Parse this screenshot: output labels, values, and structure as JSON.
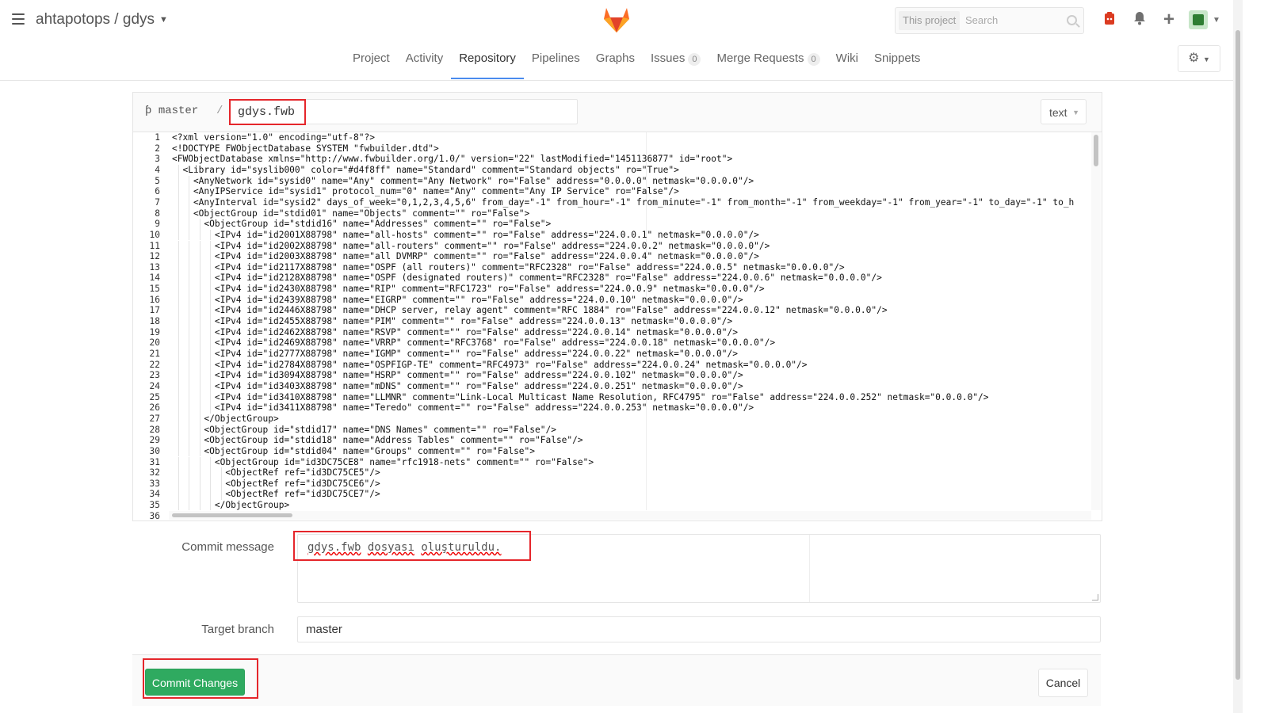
{
  "header": {
    "project_namespace": "ahtapotops",
    "project_separator": " / ",
    "project_name": "gdys",
    "search_scope": "This project",
    "search_placeholder": "Search",
    "icons": [
      "hamburger-icon",
      "gitlab-logo",
      "search-icon",
      "todo-icon",
      "bell-icon",
      "plus-icon",
      "avatar",
      "chevron-down-icon",
      "gear-icon"
    ]
  },
  "nav": {
    "tabs": [
      {
        "label": "Project"
      },
      {
        "label": "Activity"
      },
      {
        "label": "Repository",
        "active": true
      },
      {
        "label": "Pipelines"
      },
      {
        "label": "Graphs"
      },
      {
        "label": "Issues",
        "count": "0"
      },
      {
        "label": "Merge Requests",
        "count": "0"
      },
      {
        "label": "Wiki"
      },
      {
        "label": "Snippets"
      }
    ]
  },
  "file": {
    "branch": "master",
    "separator": "/",
    "filename": "gdys.fwb",
    "mode": "text"
  },
  "editor": {
    "lines": [
      "<?xml version=\"1.0\" encoding=\"utf-8\"?>",
      "<!DOCTYPE FWObjectDatabase SYSTEM \"fwbuilder.dtd\">",
      "<FWObjectDatabase xmlns=\"http://www.fwbuilder.org/1.0/\" version=\"22\" lastModified=\"1451136877\" id=\"root\">",
      "  <Library id=\"syslib000\" color=\"#d4f8ff\" name=\"Standard\" comment=\"Standard objects\" ro=\"True\">",
      "    <AnyNetwork id=\"sysid0\" name=\"Any\" comment=\"Any Network\" ro=\"False\" address=\"0.0.0.0\" netmask=\"0.0.0.0\"/>",
      "    <AnyIPService id=\"sysid1\" protocol_num=\"0\" name=\"Any\" comment=\"Any IP Service\" ro=\"False\"/>",
      "    <AnyInterval id=\"sysid2\" days_of_week=\"0,1,2,3,4,5,6\" from_day=\"-1\" from_hour=\"-1\" from_minute=\"-1\" from_month=\"-1\" from_weekday=\"-1\" from_year=\"-1\" to_day=\"-1\" to_h",
      "    <ObjectGroup id=\"stdid01\" name=\"Objects\" comment=\"\" ro=\"False\">",
      "      <ObjectGroup id=\"stdid16\" name=\"Addresses\" comment=\"\" ro=\"False\">",
      "        <IPv4 id=\"id2001X88798\" name=\"all-hosts\" comment=\"\" ro=\"False\" address=\"224.0.0.1\" netmask=\"0.0.0.0\"/>",
      "        <IPv4 id=\"id2002X88798\" name=\"all-routers\" comment=\"\" ro=\"False\" address=\"224.0.0.2\" netmask=\"0.0.0.0\"/>",
      "        <IPv4 id=\"id2003X88798\" name=\"all DVMRP\" comment=\"\" ro=\"False\" address=\"224.0.0.4\" netmask=\"0.0.0.0\"/>",
      "        <IPv4 id=\"id2117X88798\" name=\"OSPF (all routers)\" comment=\"RFC2328\" ro=\"False\" address=\"224.0.0.5\" netmask=\"0.0.0.0\"/>",
      "        <IPv4 id=\"id2128X88798\" name=\"OSPF (designated routers)\" comment=\"RFC2328\" ro=\"False\" address=\"224.0.0.6\" netmask=\"0.0.0.0\"/>",
      "        <IPv4 id=\"id2430X88798\" name=\"RIP\" comment=\"RFC1723\" ro=\"False\" address=\"224.0.0.9\" netmask=\"0.0.0.0\"/>",
      "        <IPv4 id=\"id2439X88798\" name=\"EIGRP\" comment=\"\" ro=\"False\" address=\"224.0.0.10\" netmask=\"0.0.0.0\"/>",
      "        <IPv4 id=\"id2446X88798\" name=\"DHCP server, relay agent\" comment=\"RFC 1884\" ro=\"False\" address=\"224.0.0.12\" netmask=\"0.0.0.0\"/>",
      "        <IPv4 id=\"id2455X88798\" name=\"PIM\" comment=\"\" ro=\"False\" address=\"224.0.0.13\" netmask=\"0.0.0.0\"/>",
      "        <IPv4 id=\"id2462X88798\" name=\"RSVP\" comment=\"\" ro=\"False\" address=\"224.0.0.14\" netmask=\"0.0.0.0\"/>",
      "        <IPv4 id=\"id2469X88798\" name=\"VRRP\" comment=\"RFC3768\" ro=\"False\" address=\"224.0.0.18\" netmask=\"0.0.0.0\"/>",
      "        <IPv4 id=\"id2777X88798\" name=\"IGMP\" comment=\"\" ro=\"False\" address=\"224.0.0.22\" netmask=\"0.0.0.0\"/>",
      "        <IPv4 id=\"id2784X88798\" name=\"OSPFIGP-TE\" comment=\"RFC4973\" ro=\"False\" address=\"224.0.0.24\" netmask=\"0.0.0.0\"/>",
      "        <IPv4 id=\"id3094X88798\" name=\"HSRP\" comment=\"\" ro=\"False\" address=\"224.0.0.102\" netmask=\"0.0.0.0\"/>",
      "        <IPv4 id=\"id3403X88798\" name=\"mDNS\" comment=\"\" ro=\"False\" address=\"224.0.0.251\" netmask=\"0.0.0.0\"/>",
      "        <IPv4 id=\"id3410X88798\" name=\"LLMNR\" comment=\"Link-Local Multicast Name Resolution, RFC4795\" ro=\"False\" address=\"224.0.0.252\" netmask=\"0.0.0.0\"/>",
      "        <IPv4 id=\"id3411X88798\" name=\"Teredo\" comment=\"\" ro=\"False\" address=\"224.0.0.253\" netmask=\"0.0.0.0\"/>",
      "      </ObjectGroup>",
      "      <ObjectGroup id=\"stdid17\" name=\"DNS Names\" comment=\"\" ro=\"False\"/>",
      "      <ObjectGroup id=\"stdid18\" name=\"Address Tables\" comment=\"\" ro=\"False\"/>",
      "      <ObjectGroup id=\"stdid04\" name=\"Groups\" comment=\"\" ro=\"False\">",
      "        <ObjectGroup id=\"id3DC75CE8\" name=\"rfc1918-nets\" comment=\"\" ro=\"False\">",
      "          <ObjectRef ref=\"id3DC75CE5\"/>",
      "          <ObjectRef ref=\"id3DC75CE6\"/>",
      "          <ObjectRef ref=\"id3DC75CE7\"/>",
      "        </ObjectGroup>",
      ""
    ]
  },
  "form": {
    "commit_label": "Commit message",
    "commit_words": [
      "gdys.fwb",
      "dosyası",
      "oluşturuldu."
    ],
    "target_label": "Target branch",
    "target_value": "master",
    "commit_button": "Commit Changes",
    "cancel_button": "Cancel"
  },
  "colors": {
    "accent_tab": "#4a8bee",
    "commit_button": "#2faa60",
    "annotation_red": "#e5262b"
  }
}
